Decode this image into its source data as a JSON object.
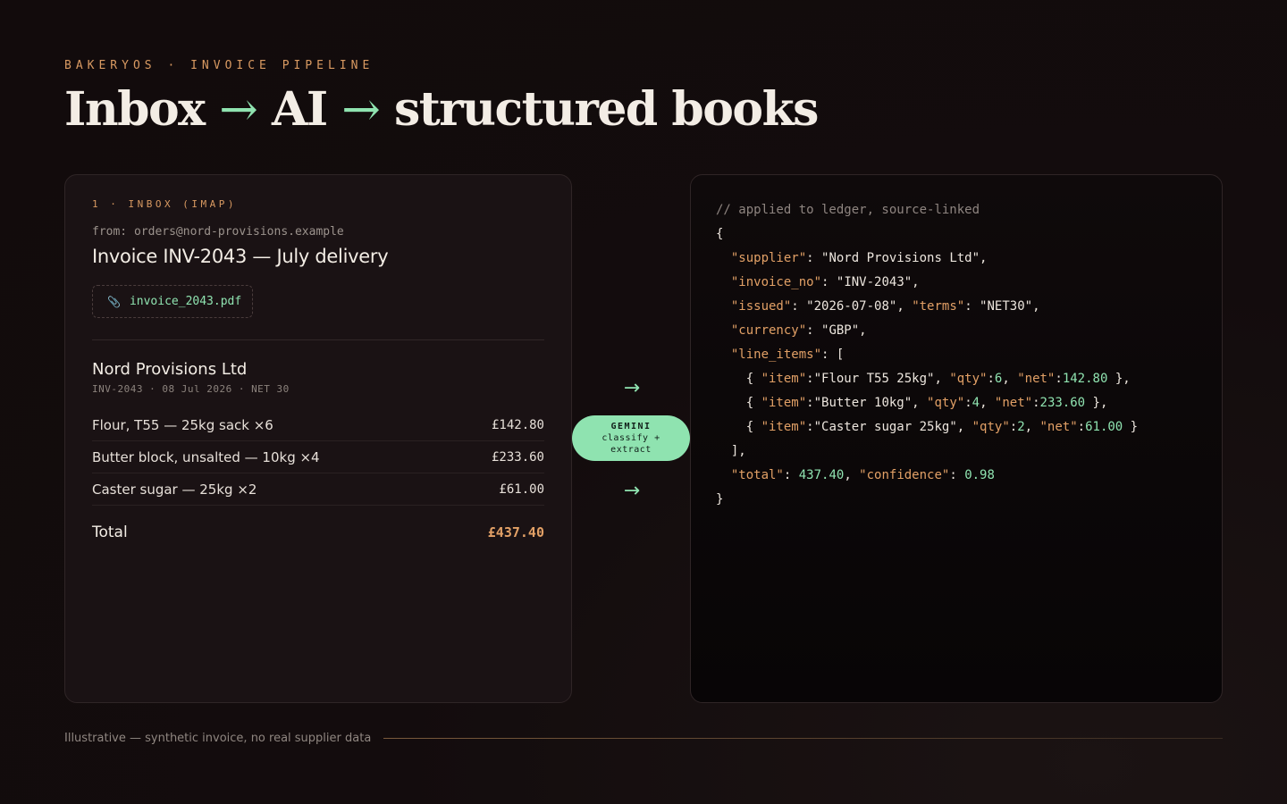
{
  "header": {
    "eyebrow": "BAKERYOS · INVOICE PIPELINE",
    "title_parts": [
      "Inbox",
      "→",
      "AI",
      "→",
      "structured books"
    ]
  },
  "inbox": {
    "section_label": "1 · INBOX (IMAP)",
    "from": "from: orders@nord-provisions.example",
    "subject": "Invoice INV-2043 — July delivery",
    "attachment": {
      "icon": "paperclip-icon",
      "name": "invoice_2043.pdf"
    },
    "supplier": "Nord Provisions Ltd",
    "meta": "INV-2043 · 08 Jul 2026 · NET 30",
    "lines": [
      {
        "desc": "Flour, T55 — 25kg sack ×6",
        "amount": "£142.80"
      },
      {
        "desc": "Butter block, unsalted — 10kg ×4",
        "amount": "£233.60"
      },
      {
        "desc": "Caster sugar — 25kg ×2",
        "amount": "£61.00"
      }
    ],
    "total_label": "Total",
    "total_amount": "£437.40"
  },
  "pipeline": {
    "arrow": "→",
    "pill_line1": "GEMINI",
    "pill_line2": "classify +",
    "pill_line3": "extract"
  },
  "ledger": {
    "comment": "// applied to ledger, source-linked",
    "supplier": "Nord Provisions Ltd",
    "invoice_no": "INV-2043",
    "issued": "2026-07-08",
    "terms": "NET30",
    "currency": "GBP",
    "line_items": [
      {
        "item": "Flour T55 25kg",
        "qty": "6",
        "net": "142.80"
      },
      {
        "item": "Butter 10kg",
        "qty": "4",
        "net": "233.60"
      },
      {
        "item": "Caster sugar 25kg",
        "qty": "2",
        "net": "61.00"
      }
    ],
    "total": "437.40",
    "confidence": "0.98"
  },
  "footer": {
    "note": "Illustrative — synthetic invoice, no real supplier data"
  },
  "colors": {
    "accent_orange": "#d99a62",
    "accent_green": "#8fe3b0",
    "background": "#130c0d"
  }
}
